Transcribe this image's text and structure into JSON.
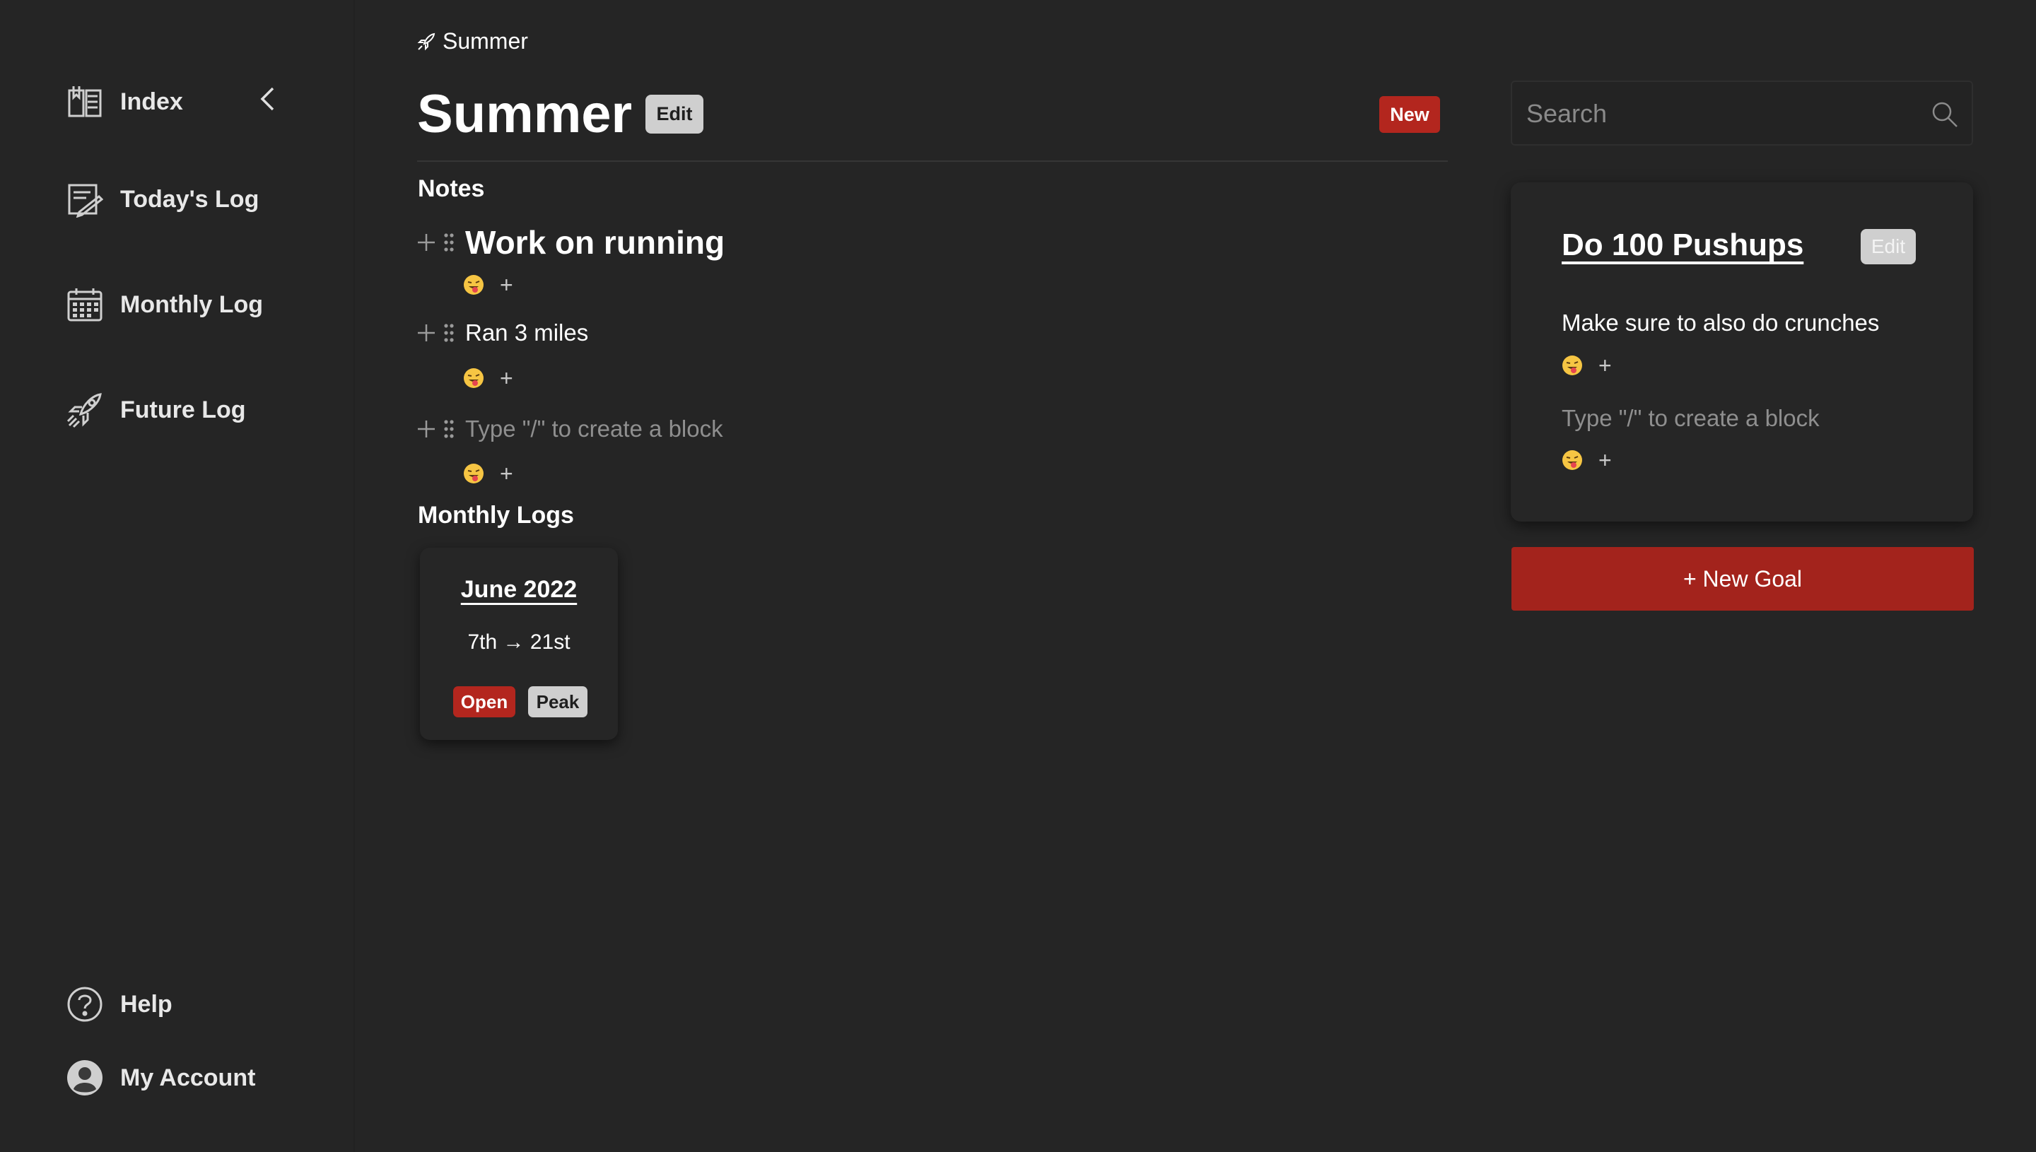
{
  "sidebar": {
    "items": [
      {
        "label": "Index",
        "icon": "book-icon"
      },
      {
        "label": "Today's Log",
        "icon": "notebook-pen-icon"
      },
      {
        "label": "Monthly Log",
        "icon": "calendar-icon"
      },
      {
        "label": "Future Log",
        "icon": "rocket-icon"
      }
    ],
    "bottom": [
      {
        "label": "Help",
        "icon": "question-circle-icon"
      },
      {
        "label": "My Account",
        "icon": "account-circle-icon"
      }
    ]
  },
  "breadcrumb": {
    "label": "Summer",
    "icon": "rocket-icon"
  },
  "page": {
    "title": "Summer",
    "edit_label": "Edit",
    "new_label": "New"
  },
  "notes": {
    "heading": "Notes",
    "blocks": [
      {
        "text": "Work on running",
        "style": "heading"
      },
      {
        "text": "Ran 3 miles",
        "style": "paragraph"
      },
      {
        "placeholder": "Type \"/\" to create a block"
      }
    ],
    "reaction_add": "+"
  },
  "monthly_logs": {
    "heading": "Monthly Logs",
    "cards": [
      {
        "title": "June 2022",
        "range": "7th → 21st",
        "open_label": "Open",
        "peak_label": "Peak"
      }
    ]
  },
  "search": {
    "placeholder": "Search"
  },
  "goal": {
    "title": "Do 100 Pushups",
    "edit_label": "Edit",
    "note": "Make sure to also do crunches",
    "placeholder": "Type \"/\" to create a block",
    "reaction_add": "+"
  },
  "new_goal_label": "+ New Goal",
  "colors": {
    "background": "#252525",
    "accent_red": "#b3261e",
    "button_grey": "#cfcfcf"
  }
}
